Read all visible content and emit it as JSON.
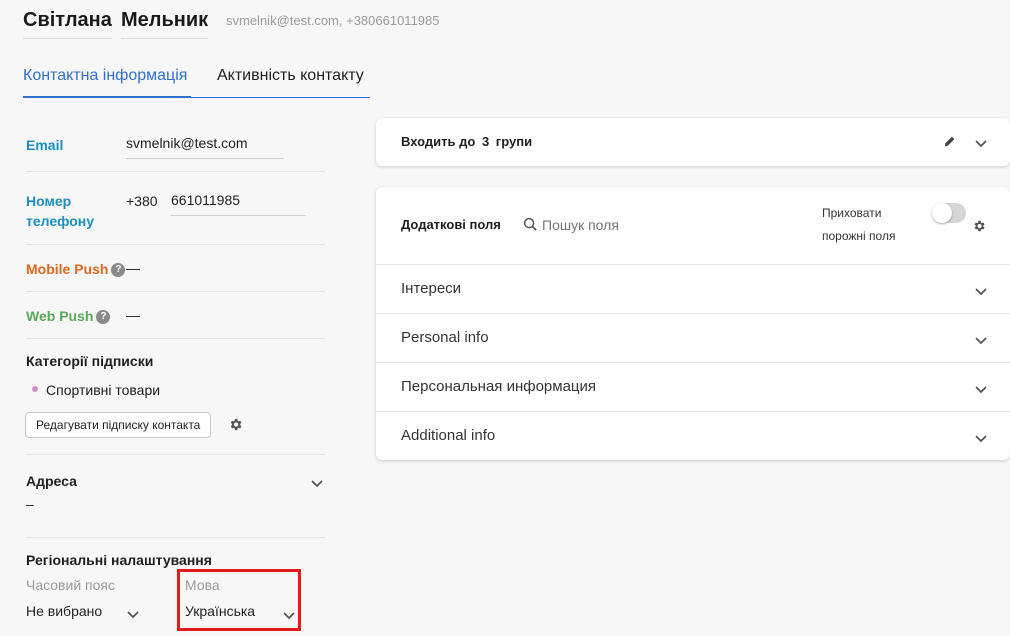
{
  "header": {
    "first_name": "Світлана",
    "last_name": "Мельник",
    "contact_line": "svmelnik@test.com, +380661011985"
  },
  "tabs": [
    {
      "label": "Контактна інформація",
      "active": true
    },
    {
      "label": "Активність контакту",
      "active": false
    }
  ],
  "contact": {
    "email_label": "Email",
    "email_value": "svmelnik@test.com",
    "phone_label_1": "Номер",
    "phone_label_2": "телефону",
    "phone_code": "+380",
    "phone_number": "661011985",
    "mobile_push_label": "Mobile Push",
    "mobile_push_value": "—",
    "web_push_label": "Web Push",
    "web_push_value": "—",
    "help_glyph": "?"
  },
  "subscriptions": {
    "title": "Категорії підписки",
    "items": [
      "Спортивні товари"
    ],
    "edit_button": "Редагувати підписку контакта"
  },
  "address": {
    "title": "Адреса",
    "value": "–"
  },
  "regional": {
    "title": "Регіональні налаштування",
    "timezone_label": "Часовий пояс",
    "timezone_value": "Не вибрано",
    "language_label": "Мова",
    "language_value": "Українська"
  },
  "groups": {
    "prefix": "Входить до",
    "count": "3",
    "suffix": "групи"
  },
  "extra_fields": {
    "title": "Додаткові поля",
    "search_placeholder": "Пошук поля",
    "hide_empty_1": "Приховати",
    "hide_empty_2": "порожні поля",
    "hide_empty_on": false,
    "sections": [
      "Інтереси",
      "Personal info",
      "Персональная информация",
      "Additional info"
    ]
  },
  "colors": {
    "accent": "#2e6fd0",
    "email_label": "#1b8fc2",
    "mobile_push_label": "#e0661d",
    "web_push_label": "#5aa85a",
    "highlight": "#e21b1b"
  },
  "icons": [
    "chevron-down-icon",
    "help-icon",
    "gear-icon",
    "pencil-icon",
    "search-icon"
  ]
}
